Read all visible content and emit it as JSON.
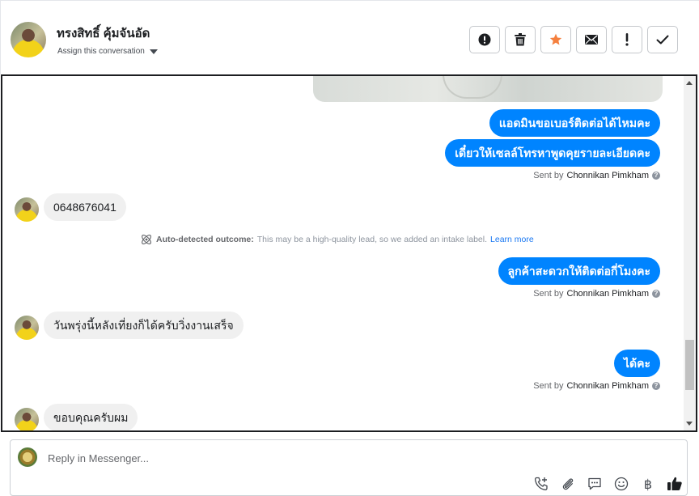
{
  "header": {
    "contact_name": "ทรงสิทธิ์ คุ้มจันอัด",
    "assign_label": "Assign this conversation",
    "actions": [
      {
        "name": "spam-button",
        "icon": "alert-circle-icon"
      },
      {
        "name": "delete-button",
        "icon": "trash-icon"
      },
      {
        "name": "star-button",
        "icon": "star-icon"
      },
      {
        "name": "mark-unread-button",
        "icon": "envelope-icon"
      },
      {
        "name": "follow-up-button",
        "icon": "exclamation-icon"
      },
      {
        "name": "mark-done-button",
        "icon": "check-icon"
      }
    ]
  },
  "messages": [
    {
      "dir": "out",
      "text": "แอดมินขอเบอร์ติดต่อได้ไหมคะ"
    },
    {
      "dir": "out",
      "text": "เดี๋ยวให้เซลล์โทรหาพูดคุยรายละเอียดคะ"
    },
    {
      "dir": "meta",
      "prefix": "Sent by",
      "agent": "Chonnikan Pimkham"
    },
    {
      "dir": "in",
      "text": "0648676041"
    },
    {
      "dir": "out",
      "text": "ลูกค้าสะดวกให้ติดต่อกี่โมงคะ"
    },
    {
      "dir": "meta",
      "prefix": "Sent by",
      "agent": "Chonnikan Pimkham"
    },
    {
      "dir": "in",
      "text": "วันพรุ่งนี้หลังเที่ยงก็ได้ครับวิ่งงานเสร็จ"
    },
    {
      "dir": "out",
      "text": "ได้คะ"
    },
    {
      "dir": "meta",
      "prefix": "Sent by",
      "agent": "Chonnikan Pimkham"
    },
    {
      "dir": "in",
      "text": "ขอบคุณครับผม"
    }
  ],
  "outcome": {
    "label": "Auto-detected outcome:",
    "text": "This may be a high-quality lead, so we added an intake label.",
    "link": "Learn more"
  },
  "composer": {
    "placeholder": "Reply in Messenger...",
    "tools": [
      "phone-add-icon",
      "paperclip-icon",
      "saved-reply-icon",
      "emoji-icon",
      "baht-icon",
      "thumbs-up-icon"
    ],
    "baht_symbol": "฿"
  },
  "colors": {
    "brand_blue": "#0084ff",
    "star": "#f5803e",
    "link": "#1877f2"
  }
}
